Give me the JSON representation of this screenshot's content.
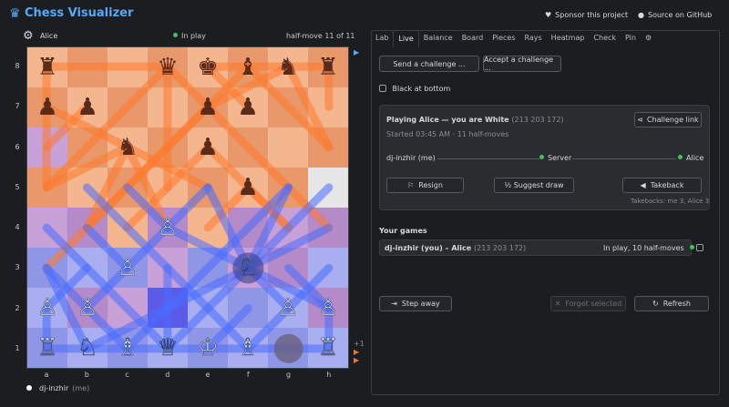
{
  "header": {
    "title": "Chess Visualizer",
    "logo_icon": "crown-icon",
    "sponsor_label": "Sponsor this project",
    "source_label": "Source on GitHub"
  },
  "opponent_bar": {
    "name": "Alice",
    "status": "In play",
    "halfmove": "half-move 11 of 11"
  },
  "board": {
    "ranks": [
      "8",
      "7",
      "6",
      "5",
      "4",
      "3",
      "2",
      "1"
    ],
    "files": [
      "a",
      "b",
      "c",
      "d",
      "e",
      "f",
      "g",
      "h"
    ],
    "pieces": [
      [
        "♜",
        "",
        "",
        "♛",
        "♚",
        "♝",
        "♞",
        "♜"
      ],
      [
        "♟",
        "♟",
        "",
        "",
        "♟",
        "♟",
        "",
        ""
      ],
      [
        "",
        "",
        "♞",
        "",
        "♟",
        "",
        "",
        ""
      ],
      [
        "",
        "",
        "",
        "",
        "",
        "♟",
        "",
        ""
      ],
      [
        "",
        "",
        "",
        "♙",
        "",
        "",
        "",
        ""
      ],
      [
        "",
        "",
        "♙",
        "",
        "",
        "♘",
        "",
        ""
      ],
      [
        "♙",
        "♙",
        "",
        "",
        "",
        "",
        "♙",
        "♙"
      ],
      [
        "♖",
        "♘",
        "♗",
        "♕",
        "♔",
        "♗",
        "",
        "♖"
      ]
    ],
    "turn_markers": [
      "+1"
    ]
  },
  "me_bar": {
    "name": "dj-inzhir",
    "sub": "(me)"
  },
  "tabs": [
    "Lab",
    "Live",
    "Balance",
    "Board",
    "Pieces",
    "Rays",
    "Heatmap",
    "Check",
    "Pin"
  ],
  "active_tab": "Live",
  "live": {
    "send_challenge": "Send a challenge ...",
    "accept_challenge": "Accept a challenge ...",
    "black_at_bottom": "Black at bottom",
    "game_title": "Playing Alice — you are White",
    "game_code": "(213 203 172)",
    "challenge_link": "Challenge link",
    "started": "Started 03:45 AM · 11 half-moves",
    "path_me": "dj-inzhir (me)",
    "path_server": "Server",
    "path_alice": "Alice",
    "resign": "Resign",
    "suggest_draw": "½ Suggest draw",
    "takeback": "Takeback",
    "takebacks": "Takebacks: me 3, Alice 3",
    "your_games": "Your games",
    "game_row_title": "dj-inzhir (you) – Alice",
    "game_row_code": "(213 203 172)",
    "game_row_status": "In play, 10 half-moves",
    "step_away": "Step away",
    "forget_selected": "Forget selected",
    "refresh": "Refresh"
  },
  "colors": {
    "accent": "#58a9f2",
    "status_green": "#41c25e",
    "ray_orange": "#ff7a2e",
    "ray_blue": "#4a6cff"
  }
}
